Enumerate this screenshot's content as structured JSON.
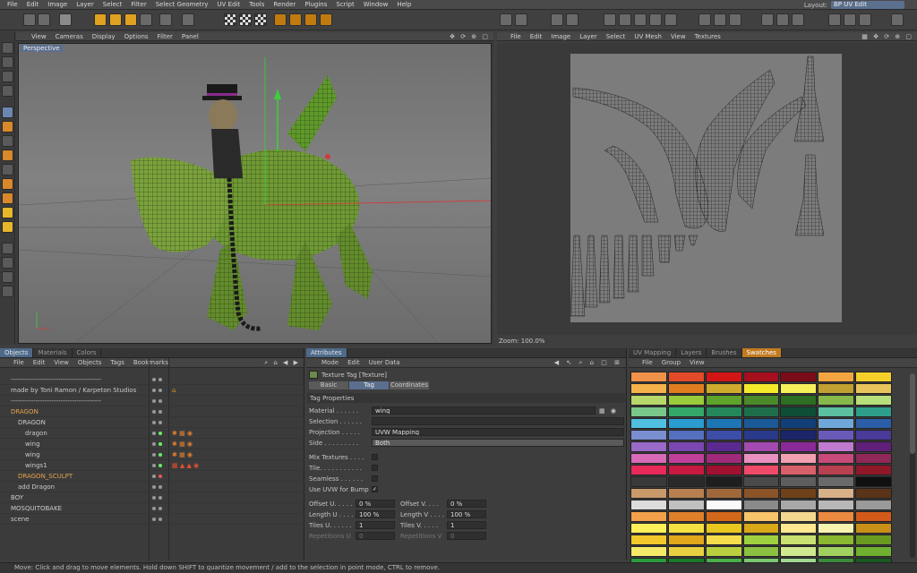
{
  "menubar": {
    "items": [
      "File",
      "Edit",
      "Image",
      "Layer",
      "Select",
      "Filter",
      "Select Geometry",
      "UV Edit",
      "Tools",
      "Render",
      "Plugins",
      "Script",
      "Window",
      "Help"
    ],
    "layout_label": "Layout:",
    "layout_value": "BP UV Edit"
  },
  "viewport": {
    "menu": [
      "View",
      "Cameras",
      "Display",
      "Options",
      "Filter",
      "Panel"
    ],
    "label": "Perspective"
  },
  "uv_panel": {
    "menu": [
      "File",
      "Edit",
      "Image",
      "Layer",
      "Select",
      "UV Mesh",
      "View",
      "Textures"
    ],
    "zoom": "Zoom: 100.0%"
  },
  "objects_panel": {
    "tabs": [
      "Objects",
      "Materials",
      "Colors"
    ],
    "menu": [
      "File",
      "Edit",
      "View",
      "Objects",
      "Tags",
      "Bookmarks"
    ],
    "rows": [
      {
        "name": "----------------------------------------",
        "indent": 0,
        "color": "normal"
      },
      {
        "name": "made by Toni Ramon / Karpeton Studios",
        "indent": 0,
        "color": "normal"
      },
      {
        "name": "----------------------------------------",
        "indent": 0,
        "color": "normal"
      },
      {
        "name": "DRAGON",
        "indent": 0,
        "color": "orange"
      },
      {
        "name": "DRAGON",
        "indent": 1,
        "color": "normal"
      },
      {
        "name": "dragon",
        "indent": 2,
        "color": "normal"
      },
      {
        "name": "wing",
        "indent": 2,
        "color": "normal"
      },
      {
        "name": "wing",
        "indent": 2,
        "color": "normal"
      },
      {
        "name": "wings1",
        "indent": 2,
        "color": "normal"
      },
      {
        "name": "DRAGON_SCULPT",
        "indent": 1,
        "color": "orange"
      },
      {
        "name": "add Dragon",
        "indent": 1,
        "color": "normal"
      },
      {
        "name": "BOY",
        "indent": 0,
        "color": "normal"
      },
      {
        "name": "MOSQUITOBAKE",
        "indent": 0,
        "color": "normal"
      },
      {
        "name": "scene",
        "indent": 0,
        "color": "normal"
      }
    ]
  },
  "attributes": {
    "tab": "Attributes",
    "menu": [
      "Mode",
      "Edit",
      "User Data"
    ],
    "title": "Texture Tag [Texture]",
    "subtabs": [
      "Basic",
      "Tag",
      "Coordinates"
    ],
    "active_subtab": "Tag",
    "section": "Tag Properties",
    "material_label": "Material . . . . . .",
    "material_value": "wing",
    "selection_label": "Selection . . . . . .",
    "selection_value": "",
    "projection_label": "Projection . . . . .",
    "projection_value": "UVW Mapping",
    "side_label": "Side . . . . . . . . .",
    "side_value": "Both",
    "mix_label": "Mix Textures . . . .",
    "tile_label": "Tile. . . . . . . . . . .",
    "seamless_label": "Seamless . . . . . .",
    "uvwbump_label": "Use UVW for Bump",
    "uvwbump_check": "✓",
    "offset_u_label": "Offset U. . . . .",
    "offset_u": "0 %",
    "offset_v_label": "Offset V. . . .",
    "offset_v": "0 %",
    "length_u_label": "Length U . . . .",
    "length_u": "100 %",
    "length_v_label": "Length V . . . .",
    "length_v": "100 %",
    "tiles_u_label": "Tiles U. . . . . .",
    "tiles_u": "1",
    "tiles_v_label": "Tiles V. . . . .",
    "tiles_v": "1",
    "rep_u_label": "Repetitions U",
    "rep_u": "0",
    "rep_v_label": "Repetitions V",
    "rep_v": "0"
  },
  "swatches": {
    "tabs": [
      "UV Mapping",
      "Layers",
      "Brushes",
      "Swatches"
    ],
    "menu": [
      "File",
      "Group",
      "View"
    ],
    "colors": [
      "#f0924a",
      "#e34a2a",
      "#d21616",
      "#a50f1e",
      "#7a0b18",
      "#f3a541",
      "#f5d02a",
      "#f5b24a",
      "#e07e1f",
      "#cfaa2c",
      "#f4ea2a",
      "#f5f05a",
      "#c0a030",
      "#e8c45a",
      "#b7d76a",
      "#9acb3a",
      "#5ea32a",
      "#4a8a2a",
      "#2d6e22",
      "#86b84a",
      "#b8e07a",
      "#7ac78a",
      "#34a868",
      "#24885a",
      "#1e6e4a",
      "#0f4e36",
      "#5ac0a0",
      "#2e9e8a",
      "#4fc0e0",
      "#2a9cd0",
      "#1d76b4",
      "#1a5a98",
      "#133f78",
      "#6fa8d8",
      "#2c5ea8",
      "#7a8fd0",
      "#5670c0",
      "#3c4ea8",
      "#2a3a8a",
      "#1a2668",
      "#6a5ab8",
      "#4a3a9a",
      "#9a6ac8",
      "#7a48b0",
      "#5a2a90",
      "#a24ab0",
      "#8a2a98",
      "#c07ad0",
      "#60207a",
      "#d86ab8",
      "#c0409a",
      "#a02a7a",
      "#e890c0",
      "#f0a0b0",
      "#c84a7a",
      "#902858",
      "#e82a5a",
      "#c81a40",
      "#a01030",
      "#f04a6a",
      "#d8606a",
      "#b84050",
      "#901828",
      "#3a3a3a",
      "#2a2a2a",
      "#1e1e1e",
      "#4a4a4a",
      "#5e5e5e",
      "#6a6a6a",
      "#101010",
      "#c89a6a",
      "#b88050",
      "#a0683a",
      "#8a5428",
      "#704018",
      "#d8b088",
      "#5a3418",
      "#dcdcdc",
      "#c0c0c0",
      "#fafafa",
      "#8a8a8a",
      "#a8a8a8",
      "#b8b8b8",
      "#9a9a9a",
      "#f2a14a",
      "#e07f2a",
      "#d4681a",
      "#f8c46a",
      "#f4d890",
      "#ec8a40",
      "#d45a1a",
      "#fff05a",
      "#f4e040",
      "#e8c820",
      "#d8a818",
      "#ffe890",
      "#f8f4b0",
      "#c89018",
      "#f2c82a",
      "#e0a81a",
      "#f4dc4a",
      "#9ed040",
      "#c8e070",
      "#8ab830",
      "#6a9a20",
      "#f4ea6a",
      "#e8d040",
      "#b8d040",
      "#8cc040",
      "#d0e890",
      "#a0d060",
      "#70b030",
      "#2a9a3a",
      "#1a7a2a",
      "#4ab04a",
      "#7ac870",
      "#a0d890",
      "#3a8a3a",
      "#1a5a20"
    ]
  },
  "status": "Move: Click and drag to move elements. Hold down SHIFT to quantize movement / add to the selection in point mode, CTRL to remove."
}
